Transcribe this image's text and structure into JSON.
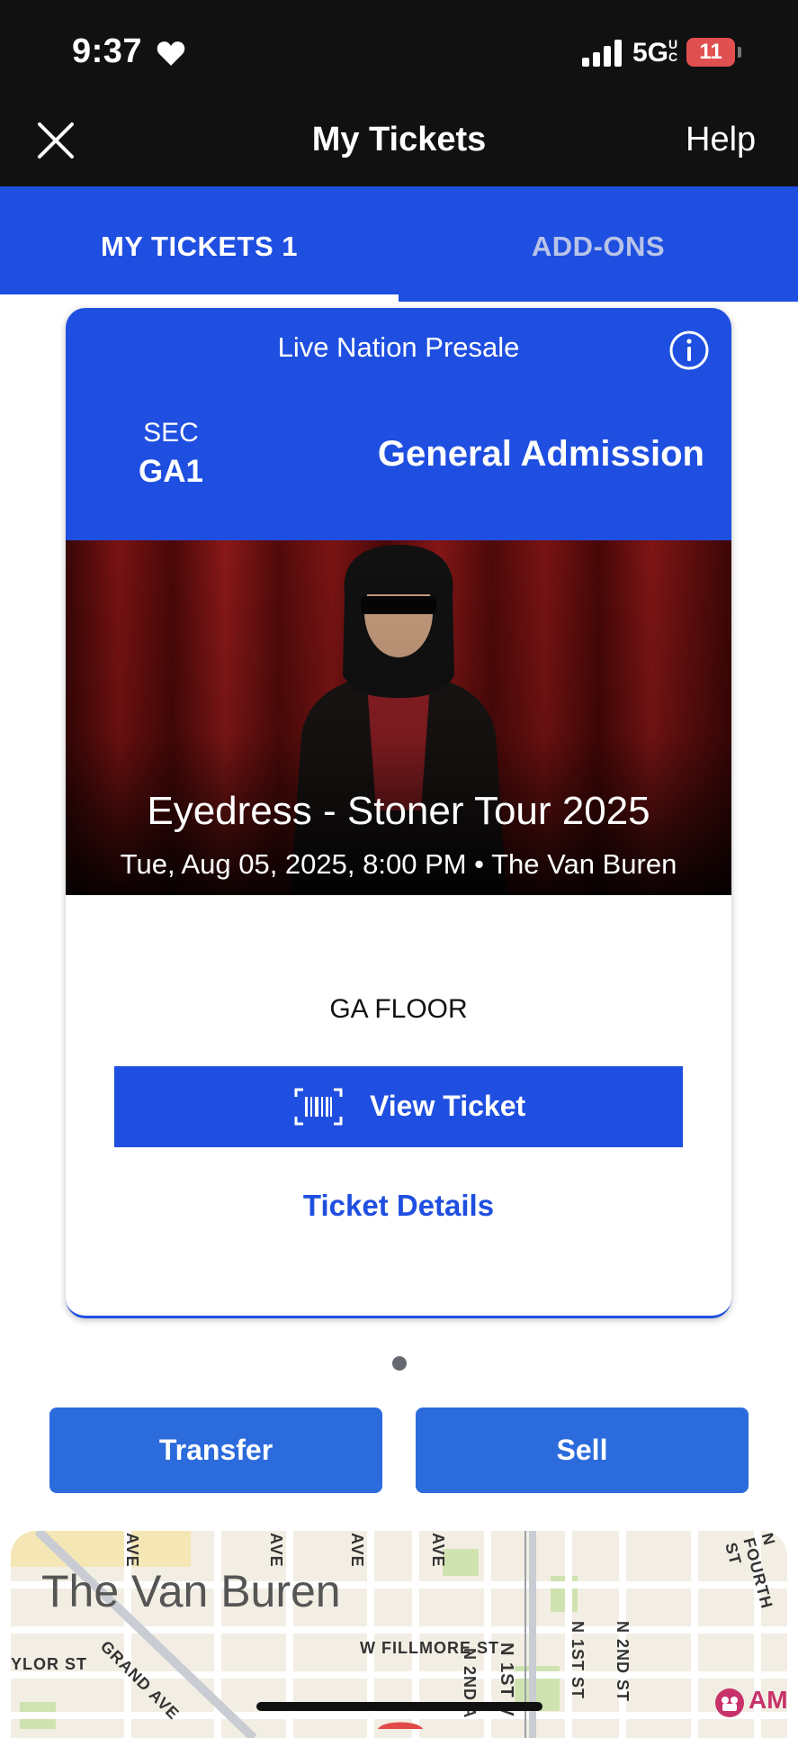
{
  "status_bar": {
    "time": "9:37",
    "network": "5G",
    "network_superscript": "UC",
    "battery": "11"
  },
  "nav": {
    "title": "My Tickets",
    "help_label": "Help",
    "close_icon": "close-icon"
  },
  "tabs": [
    {
      "label": "MY TICKETS 1",
      "selected": true
    },
    {
      "label": "ADD-ONS",
      "selected": false
    }
  ],
  "ticket": {
    "presale_label": "Live Nation Presale",
    "section_label": "SEC",
    "section_value": "GA1",
    "admission_type": "General Admission",
    "event_title": "Eyedress - Stoner Tour 2025",
    "event_subtitle": "Tue, Aug 05, 2025, 8:00 PM • The Van Buren",
    "area_label": "GA FLOOR",
    "view_ticket_label": "View Ticket",
    "ticket_details_label": "Ticket Details"
  },
  "actions": {
    "transfer_label": "Transfer",
    "sell_label": "Sell"
  },
  "map": {
    "venue_label": "The Van Buren",
    "streets": {
      "fillmore": "W FILLMORE ST",
      "grand": "GRAND AVE",
      "taylor": "YLOR ST",
      "first": "N 1ST ST",
      "second": "N 2ND ST",
      "fourth": "N FOURTH ST",
      "n2nd": "N 2ND A",
      "n1st": "N 1ST V",
      "ave1": "AVE",
      "ave2": "AVE",
      "ave3": "AVE",
      "ave4": "AVE"
    },
    "am_label": "AM"
  },
  "colors": {
    "brand_blue": "#1f4fe0",
    "button_blue": "#2b6bdc",
    "status_bg": "#111111"
  }
}
